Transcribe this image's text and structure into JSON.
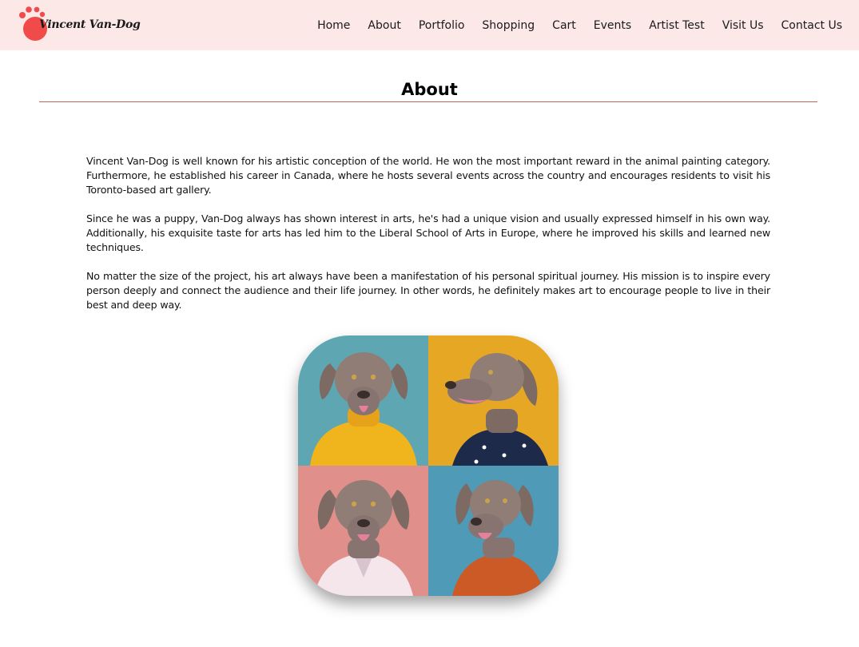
{
  "brand": {
    "logo_text": "Vincent Van-Dog",
    "accent": "#f04a4a"
  },
  "nav": {
    "items": [
      "Home",
      "About",
      "Portfolio",
      "Shopping",
      "Cart",
      "Events",
      "Artist Test",
      "Visit Us",
      "Contact Us"
    ]
  },
  "page": {
    "title": "About",
    "paragraphs": [
      "Vincent Van-Dog is well known for his artistic conception of the world. He won the most important reward in the animal painting category. Furthermore, he established his career in Canada, where he hosts several events across the country and encourages residents to visit his Toronto-based art gallery.",
      "Since he was a puppy, Van-Dog always has shown interest in arts, he's had a unique vision and usually expressed himself in his own way. Additionally, his exquisite taste for arts has led him to the Liberal School of Arts in Europe, where he improved his skills and learned new techniques.",
      "No matter the size of the project, his art always have been a manifestation of his personal spiritual journey. His mission is to inspire every person deeply and connect the audience and their life journey. In other words, he definitely makes art to encourage people to live in their best and deep way."
    ]
  },
  "colors": {
    "header_bg": "#fde8e8",
    "title_rule": "#c0655e",
    "tile_backgrounds": [
      "#5fa6b3",
      "#e6a724",
      "#e08f8b",
      "#4f9ab7"
    ],
    "outfits": [
      "#f0b41c",
      "#1e2a4a",
      "#f4e6ea",
      "#cc5a26"
    ]
  }
}
